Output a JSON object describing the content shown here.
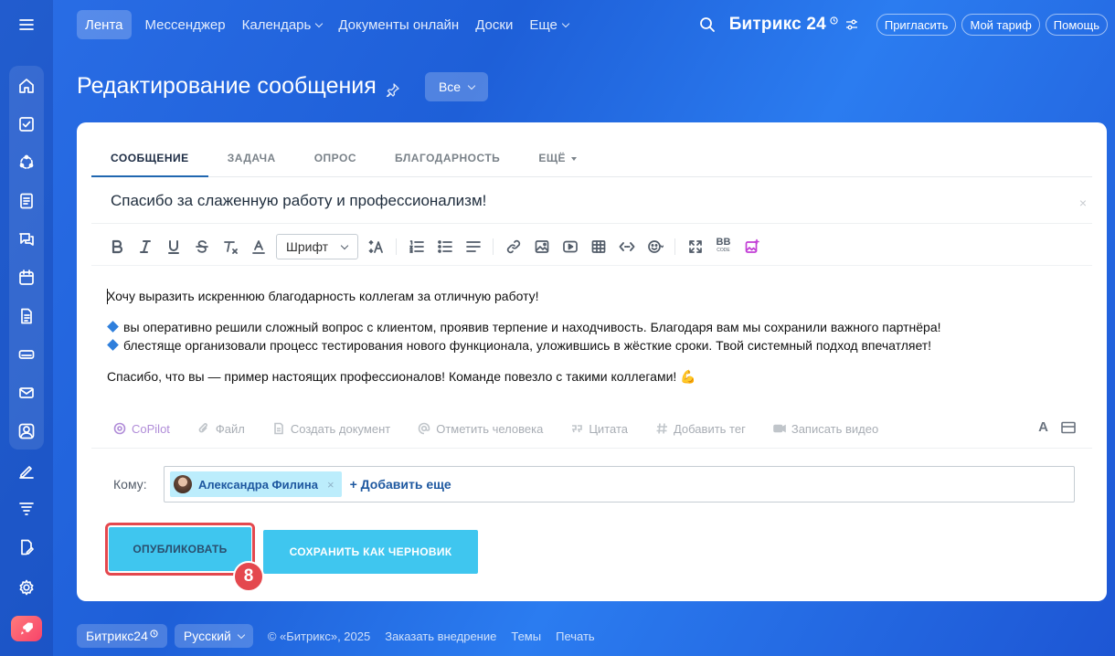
{
  "colors": {
    "accent": "#3fc6ef",
    "highlight_red": "#e4484e",
    "link": "#1e58a0",
    "background": "#2a6ee6"
  },
  "sidebar": {
    "icons": [
      "menu-icon",
      "home-icon",
      "tasks-icon",
      "sites-icon",
      "feed-icon",
      "chat-icon",
      "calendar-icon",
      "document-icon",
      "drive-icon",
      "mail-icon",
      "contacts-icon",
      "sign-icon",
      "funnel-icon",
      "edit-doc-icon",
      "settings-icon",
      "rocket-icon"
    ]
  },
  "nav": {
    "items": [
      "Лента",
      "Мессенджер",
      "Календарь",
      "Документы онлайн",
      "Доски",
      "Еще"
    ],
    "brand": "Битрикс 24",
    "invite": "Пригласить",
    "tariff": "Мой тариф",
    "help": "Помощь"
  },
  "page": {
    "title": "Редактирование сообщения",
    "filter": "Все"
  },
  "composer": {
    "tabs": [
      "СООБЩЕНИЕ",
      "ЗАДАЧА",
      "ОПРОС",
      "БЛАГОДАРНОСТЬ",
      "ЕЩЁ"
    ],
    "subject": "Спасибо за слаженную работу и профессионализм!",
    "subject_close": "×",
    "font_select": "Шрифт",
    "bb_code": "BB",
    "body": {
      "p1": "Хочу выразить искреннюю благодарность коллегам за отличную работу!",
      "b1": "вы оперативно решили сложный вопрос с клиентом, проявив терпение и находчивость. Благодаря вам мы сохранили важного партнёра!",
      "b2": "блестяще организовали процесс тестирования нового функционала, уложившись в жёсткие сроки. Твой системный подход впечатляет!",
      "p2": "Спасибо, что вы — пример настоящих профессионалов! Команде повезло с такими коллегами! 💪"
    },
    "actions": {
      "copilot": "CoPilot",
      "file": "Файл",
      "create_doc": "Создать документ",
      "mention": "Отметить человека",
      "quote": "Цитата",
      "tag": "Добавить тег",
      "video": "Записать видео",
      "format": "A"
    },
    "to_label": "Кому:",
    "recipient": "Александра Филина",
    "recipient_remove": "×",
    "add_more": "+ Добавить еще",
    "publish": "ОПУБЛИКОВАТЬ",
    "draft": "СОХРАНИТЬ КАК ЧЕРНОВИК",
    "step": "8"
  },
  "footer": {
    "brand": "Битрикс24",
    "language": "Русский",
    "copyright": "© «Битрикс», 2025",
    "order": "Заказать внедрение",
    "themes": "Темы",
    "print": "Печать"
  }
}
